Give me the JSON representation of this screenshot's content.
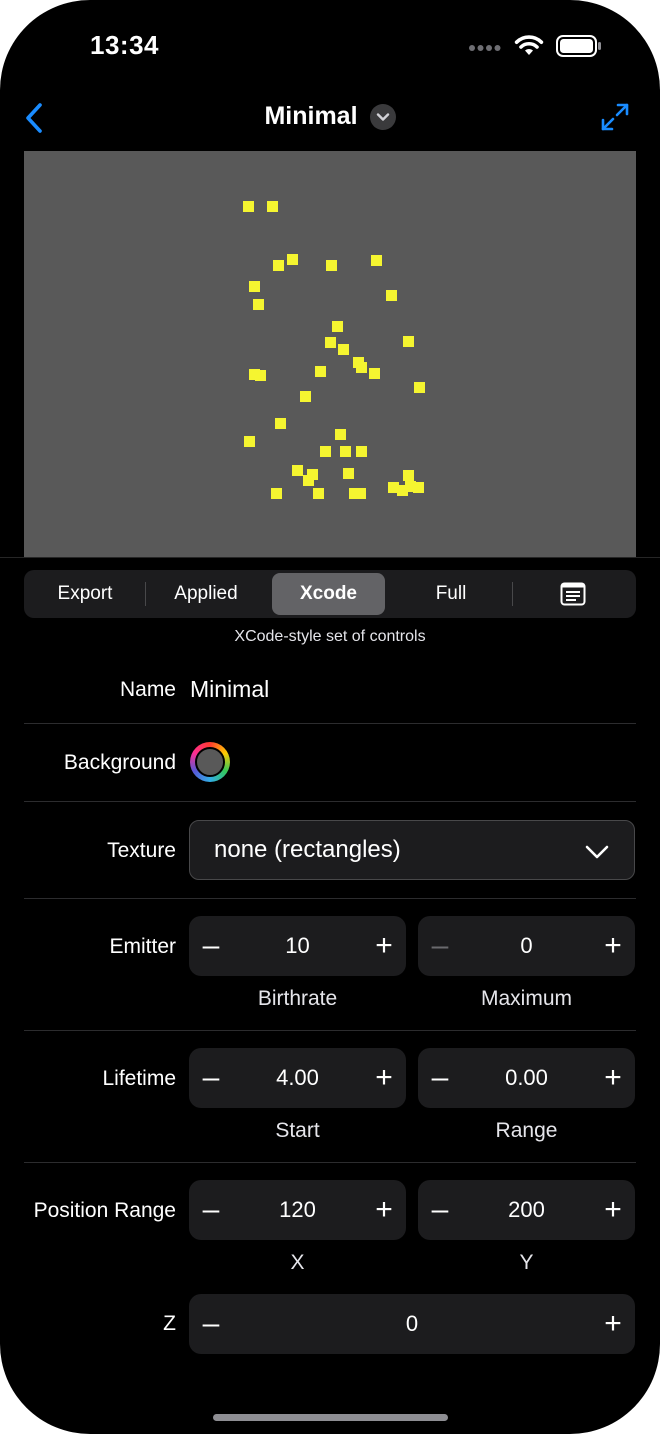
{
  "status_bar": {
    "time": "13:34"
  },
  "nav": {
    "title": "Minimal"
  },
  "preview": {
    "background_color": "#595959",
    "particle_color": "#f5f530",
    "particles": [
      [
        248,
        206
      ],
      [
        272,
        206
      ],
      [
        292,
        259
      ],
      [
        278,
        265
      ],
      [
        331,
        265
      ],
      [
        376,
        260
      ],
      [
        254,
        286
      ],
      [
        391,
        295
      ],
      [
        258,
        304
      ],
      [
        337,
        326
      ],
      [
        330,
        342
      ],
      [
        343,
        349
      ],
      [
        408,
        341
      ],
      [
        358,
        362
      ],
      [
        361,
        367
      ],
      [
        374,
        373
      ],
      [
        254,
        374
      ],
      [
        260,
        375
      ],
      [
        320,
        371
      ],
      [
        419,
        387
      ],
      [
        305,
        396
      ],
      [
        280,
        423
      ],
      [
        340,
        434
      ],
      [
        249,
        441
      ],
      [
        325,
        451
      ],
      [
        345,
        451
      ],
      [
        361,
        451
      ],
      [
        297,
        470
      ],
      [
        312,
        474
      ],
      [
        308,
        480
      ],
      [
        348,
        473
      ],
      [
        408,
        475
      ],
      [
        393,
        487
      ],
      [
        402,
        490
      ],
      [
        410,
        486
      ],
      [
        418,
        487
      ],
      [
        276,
        493
      ],
      [
        318,
        493
      ],
      [
        354,
        493
      ],
      [
        360,
        493
      ]
    ]
  },
  "tabs": {
    "items": [
      "Export",
      "Applied",
      "Xcode",
      "Full"
    ],
    "selected": "Xcode",
    "caption": "XCode-style set of controls"
  },
  "form": {
    "name_label": "Name",
    "name_value": "Minimal",
    "background_label": "Background",
    "background_color": "#595959",
    "texture_label": "Texture",
    "texture_value": "none (rectangles)",
    "emitter_label": "Emitter",
    "birthrate_value": "10",
    "birthrate_label": "Birthrate",
    "maximum_value": "0",
    "maximum_label": "Maximum",
    "lifetime_label": "Lifetime",
    "start_value": "4.00",
    "start_label": "Start",
    "range_value": "0.00",
    "range_label": "Range",
    "position_label": "Position Range",
    "x_value": "120",
    "x_label": "X",
    "y_value": "200",
    "y_label": "Y",
    "z_label": "Z",
    "z_value": "0",
    "minus_symbol": "–",
    "plus_symbol": "+"
  }
}
